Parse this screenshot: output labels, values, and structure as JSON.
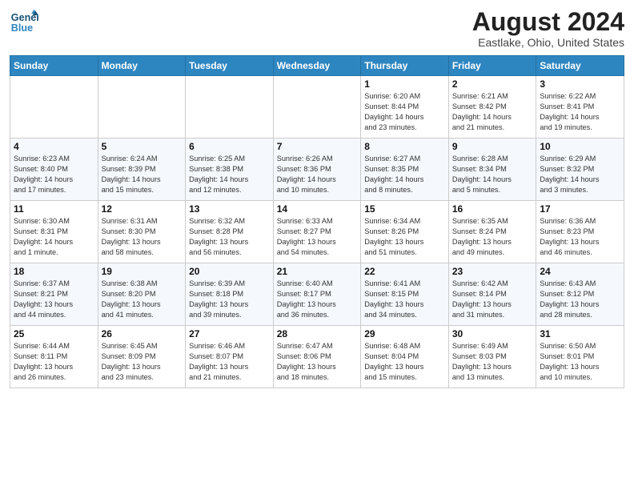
{
  "header": {
    "logo_line1": "General",
    "logo_line2": "Blue",
    "title": "August 2024",
    "location": "Eastlake, Ohio, United States"
  },
  "weekdays": [
    "Sunday",
    "Monday",
    "Tuesday",
    "Wednesday",
    "Thursday",
    "Friday",
    "Saturday"
  ],
  "weeks": [
    [
      {
        "day": "",
        "info": ""
      },
      {
        "day": "",
        "info": ""
      },
      {
        "day": "",
        "info": ""
      },
      {
        "day": "",
        "info": ""
      },
      {
        "day": "1",
        "info": "Sunrise: 6:20 AM\nSunset: 8:44 PM\nDaylight: 14 hours\nand 23 minutes."
      },
      {
        "day": "2",
        "info": "Sunrise: 6:21 AM\nSunset: 8:42 PM\nDaylight: 14 hours\nand 21 minutes."
      },
      {
        "day": "3",
        "info": "Sunrise: 6:22 AM\nSunset: 8:41 PM\nDaylight: 14 hours\nand 19 minutes."
      }
    ],
    [
      {
        "day": "4",
        "info": "Sunrise: 6:23 AM\nSunset: 8:40 PM\nDaylight: 14 hours\nand 17 minutes."
      },
      {
        "day": "5",
        "info": "Sunrise: 6:24 AM\nSunset: 8:39 PM\nDaylight: 14 hours\nand 15 minutes."
      },
      {
        "day": "6",
        "info": "Sunrise: 6:25 AM\nSunset: 8:38 PM\nDaylight: 14 hours\nand 12 minutes."
      },
      {
        "day": "7",
        "info": "Sunrise: 6:26 AM\nSunset: 8:36 PM\nDaylight: 14 hours\nand 10 minutes."
      },
      {
        "day": "8",
        "info": "Sunrise: 6:27 AM\nSunset: 8:35 PM\nDaylight: 14 hours\nand 8 minutes."
      },
      {
        "day": "9",
        "info": "Sunrise: 6:28 AM\nSunset: 8:34 PM\nDaylight: 14 hours\nand 5 minutes."
      },
      {
        "day": "10",
        "info": "Sunrise: 6:29 AM\nSunset: 8:32 PM\nDaylight: 14 hours\nand 3 minutes."
      }
    ],
    [
      {
        "day": "11",
        "info": "Sunrise: 6:30 AM\nSunset: 8:31 PM\nDaylight: 14 hours\nand 1 minute."
      },
      {
        "day": "12",
        "info": "Sunrise: 6:31 AM\nSunset: 8:30 PM\nDaylight: 13 hours\nand 58 minutes."
      },
      {
        "day": "13",
        "info": "Sunrise: 6:32 AM\nSunset: 8:28 PM\nDaylight: 13 hours\nand 56 minutes."
      },
      {
        "day": "14",
        "info": "Sunrise: 6:33 AM\nSunset: 8:27 PM\nDaylight: 13 hours\nand 54 minutes."
      },
      {
        "day": "15",
        "info": "Sunrise: 6:34 AM\nSunset: 8:26 PM\nDaylight: 13 hours\nand 51 minutes."
      },
      {
        "day": "16",
        "info": "Sunrise: 6:35 AM\nSunset: 8:24 PM\nDaylight: 13 hours\nand 49 minutes."
      },
      {
        "day": "17",
        "info": "Sunrise: 6:36 AM\nSunset: 8:23 PM\nDaylight: 13 hours\nand 46 minutes."
      }
    ],
    [
      {
        "day": "18",
        "info": "Sunrise: 6:37 AM\nSunset: 8:21 PM\nDaylight: 13 hours\nand 44 minutes."
      },
      {
        "day": "19",
        "info": "Sunrise: 6:38 AM\nSunset: 8:20 PM\nDaylight: 13 hours\nand 41 minutes."
      },
      {
        "day": "20",
        "info": "Sunrise: 6:39 AM\nSunset: 8:18 PM\nDaylight: 13 hours\nand 39 minutes."
      },
      {
        "day": "21",
        "info": "Sunrise: 6:40 AM\nSunset: 8:17 PM\nDaylight: 13 hours\nand 36 minutes."
      },
      {
        "day": "22",
        "info": "Sunrise: 6:41 AM\nSunset: 8:15 PM\nDaylight: 13 hours\nand 34 minutes."
      },
      {
        "day": "23",
        "info": "Sunrise: 6:42 AM\nSunset: 8:14 PM\nDaylight: 13 hours\nand 31 minutes."
      },
      {
        "day": "24",
        "info": "Sunrise: 6:43 AM\nSunset: 8:12 PM\nDaylight: 13 hours\nand 28 minutes."
      }
    ],
    [
      {
        "day": "25",
        "info": "Sunrise: 6:44 AM\nSunset: 8:11 PM\nDaylight: 13 hours\nand 26 minutes."
      },
      {
        "day": "26",
        "info": "Sunrise: 6:45 AM\nSunset: 8:09 PM\nDaylight: 13 hours\nand 23 minutes."
      },
      {
        "day": "27",
        "info": "Sunrise: 6:46 AM\nSunset: 8:07 PM\nDaylight: 13 hours\nand 21 minutes."
      },
      {
        "day": "28",
        "info": "Sunrise: 6:47 AM\nSunset: 8:06 PM\nDaylight: 13 hours\nand 18 minutes."
      },
      {
        "day": "29",
        "info": "Sunrise: 6:48 AM\nSunset: 8:04 PM\nDaylight: 13 hours\nand 15 minutes."
      },
      {
        "day": "30",
        "info": "Sunrise: 6:49 AM\nSunset: 8:03 PM\nDaylight: 13 hours\nand 13 minutes."
      },
      {
        "day": "31",
        "info": "Sunrise: 6:50 AM\nSunset: 8:01 PM\nDaylight: 13 hours\nand 10 minutes."
      }
    ]
  ]
}
